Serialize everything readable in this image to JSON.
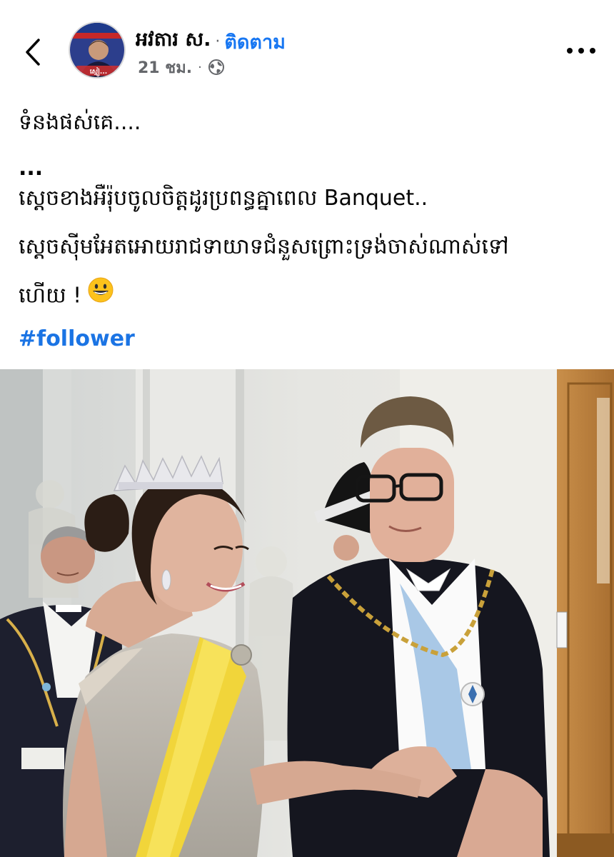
{
  "header": {
    "author_name": "អវតារ ស.",
    "separator": "·",
    "follow_label": "ติดตาม",
    "time": "21 ชม.",
    "meta_separator": "·",
    "avatar_caption": "ស្មៀ..."
  },
  "post": {
    "lines": [
      "ទំនងផស់គេ....",
      "...",
      "ស្តេចខាងអឺរ៉ុបចូលចិត្តដូរប្រពន្ធគ្នាពេល Banquet..",
      "ស្តេចស៊ីមអែតអោយរាជទាយាទជំនួសព្រោះទ្រង់ចាស់ណាស់ទៅ",
      "ហើយ !"
    ],
    "hashtag": "#follower"
  },
  "icons": {
    "back": "chevron-left-icon",
    "privacy": "globe-icon",
    "more": "more-horizontal-icon",
    "emoji": "grinning-face-emoji"
  },
  "colors": {
    "link_blue": "#1877f2",
    "hashtag_blue": "#1b74e4",
    "meta_gray": "#65676b"
  }
}
